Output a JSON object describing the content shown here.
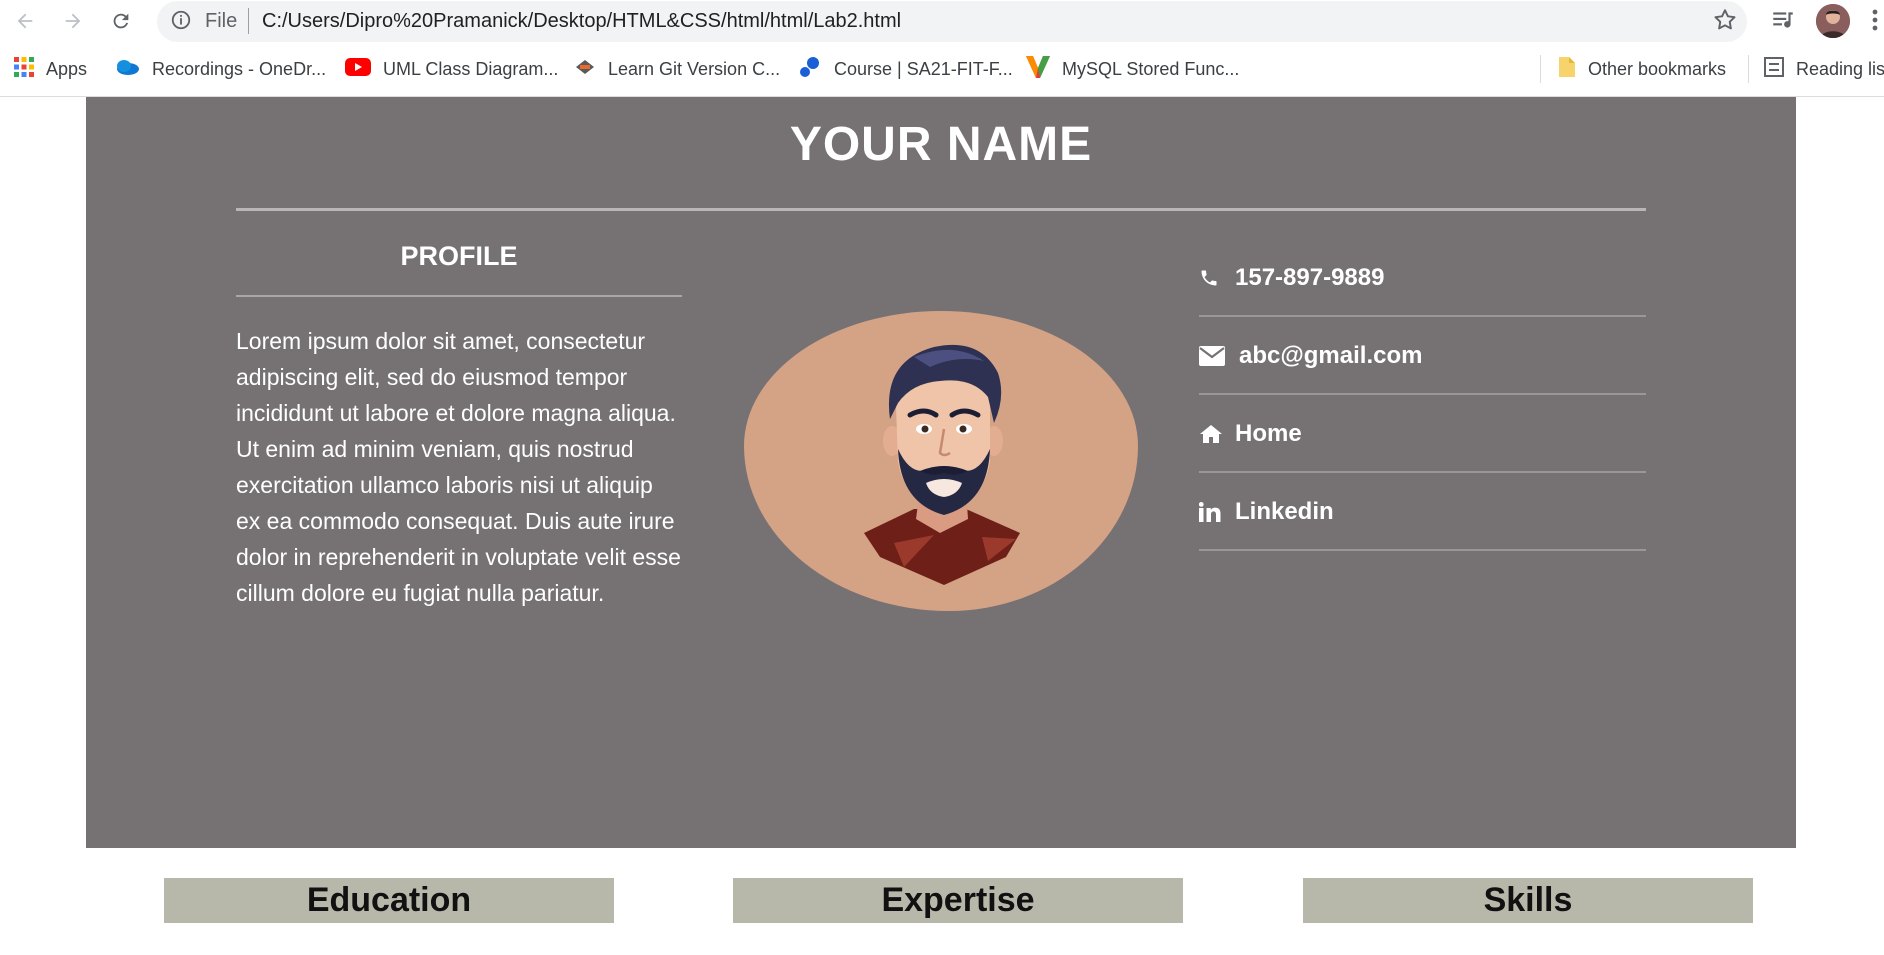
{
  "browser": {
    "omnibox": {
      "scheme": "File",
      "url": "C:/Users/Dipro%20Pramanick/Desktop/HTML&CSS/html/html/Lab2.html"
    },
    "bookmarks": [
      {
        "label": "Apps",
        "icon": "apps-grid-icon"
      },
      {
        "label": "Recordings - OneDr...",
        "icon": "onedrive-icon"
      },
      {
        "label": "UML Class Diagram...",
        "icon": "youtube-icon"
      },
      {
        "label": "Learn Git Version C...",
        "icon": "git-course-icon"
      },
      {
        "label": "Course | SA21-FIT-F...",
        "icon": "course-icon"
      },
      {
        "label": "MySQL Stored Func...",
        "icon": "mysql-icon"
      },
      {
        "label": "Other bookmarks",
        "icon": "folder-icon"
      },
      {
        "label": "Reading lis",
        "icon": "reading-list-icon"
      }
    ]
  },
  "resume": {
    "name": "YOUR NAME",
    "profile": {
      "heading": "PROFILE",
      "text": "Lorem ipsum dolor sit amet, consectetur adipiscing elit, sed do eiusmod tempor incididunt ut labore et dolore magna aliqua. Ut enim ad minim veniam, quis nostrud exercitation ullamco laboris nisi ut aliquip ex ea commodo consequat. Duis aute irure dolor in reprehenderit in voluptate velit esse cillum dolore eu fugiat nulla pariatur."
    },
    "contacts": [
      {
        "icon": "phone-icon",
        "label": "157-897-9889"
      },
      {
        "icon": "envelope-icon",
        "label": "abc@gmail.com"
      },
      {
        "icon": "home-icon",
        "label": "Home"
      },
      {
        "icon": "linkedin-icon",
        "label": "Linkedin"
      }
    ],
    "tabs": [
      "Education",
      "Expertise",
      "Skills"
    ]
  },
  "colors": {
    "hero_bg": "#767273",
    "avatar_blob": "#d4a285",
    "tab_bg": "#b8b8aa"
  }
}
